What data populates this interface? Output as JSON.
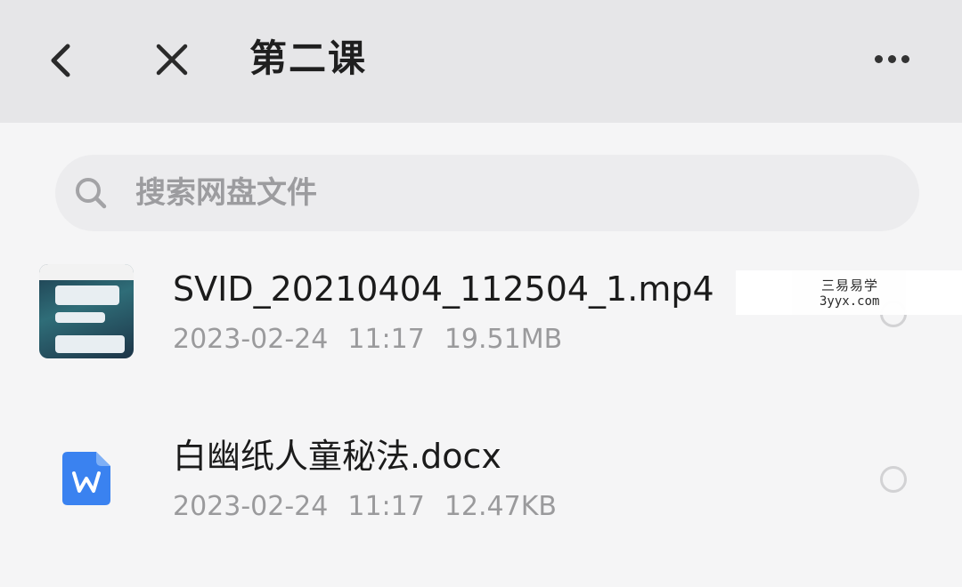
{
  "header": {
    "title": "第二课"
  },
  "search": {
    "placeholder": "搜索网盘文件"
  },
  "files": [
    {
      "name": "SVID_20210404_112504_1.mp4",
      "date": "2023-02-24",
      "time": "11:17",
      "size": "19.51MB",
      "icon": "video-thumbnail"
    },
    {
      "name": "白幽纸人童秘法.docx",
      "date": "2023-02-24",
      "time": "11:17",
      "size": "12.47KB",
      "icon": "word-doc-icon"
    }
  ],
  "watermark": {
    "text_cn": "三易易学",
    "text_url": "3yyx.com"
  },
  "colors": {
    "header_bg": "#e6e6e8",
    "word_blue": "#3a82f0"
  }
}
